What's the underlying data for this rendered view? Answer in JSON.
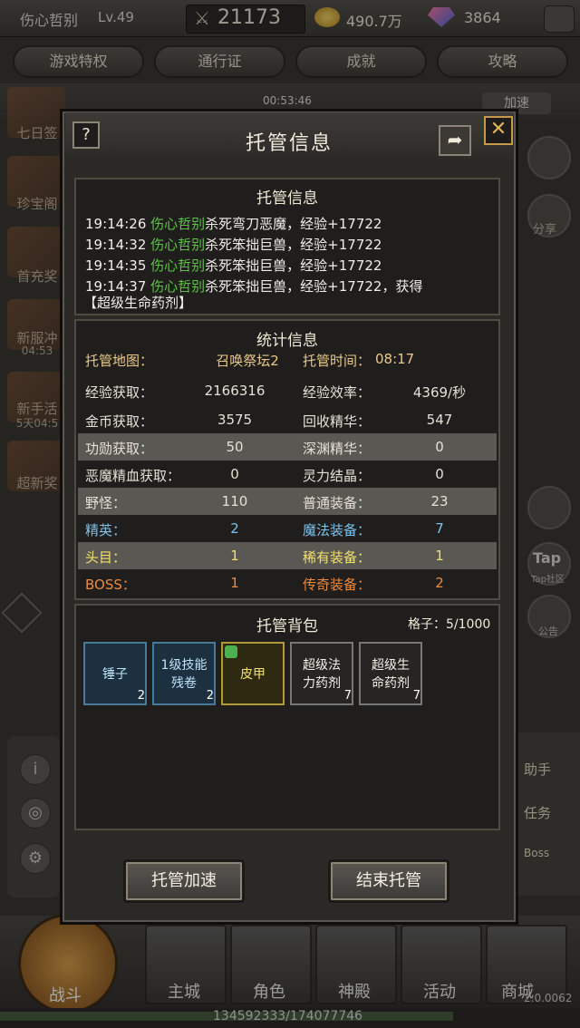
{
  "top": {
    "player_name": "伤心哲别",
    "level": "Lv.49",
    "power": "21173",
    "gold": "490.7万",
    "gems": "3864"
  },
  "tabs": [
    "游戏特权",
    "通行证",
    "成就",
    "攻略"
  ],
  "hud": {
    "timer": "00:53:46",
    "speed": "加速"
  },
  "left_side": [
    "七日签",
    "珍宝阁",
    "首充奖",
    "新服冲",
    "新手活",
    "超新奖"
  ],
  "left_side_sub": [
    "04:53",
    "5天04:5"
  ],
  "right_side_labels": [
    "分享",
    "Tap",
    "Tap社区",
    "公告"
  ],
  "right_panel": [
    "助手",
    "任务",
    "Boss"
  ],
  "bottom_nav": [
    "战斗",
    "主城",
    "角色",
    "神殿",
    "活动",
    "商城"
  ],
  "exp_text": "134592333/174077746",
  "version": "2.0.0062",
  "modal": {
    "title": "托管信息",
    "help": "?",
    "close": "✕",
    "log_section_title": "托管信息",
    "log": [
      {
        "time": "19:14:26",
        "actor": "伤心哲别",
        "text": "杀死弯刀恶魔，经验+17722"
      },
      {
        "time": "19:14:32",
        "actor": "伤心哲别",
        "text": "杀死笨拙巨兽，经验+17722"
      },
      {
        "time": "19:14:35",
        "actor": "伤心哲别",
        "text": "杀死笨拙巨兽，经验+17722"
      },
      {
        "time": "19:14:37",
        "actor": "伤心哲别",
        "text": "杀死笨拙巨兽，经验+17722，获得"
      }
    ],
    "log_tail": "【超级生命药剂】",
    "stats_title": "统计信息",
    "stats": [
      {
        "l1": "托管地图：",
        "v1": "召唤祭坛2",
        "l2": "托管时间：",
        "v2": "08:17"
      },
      {
        "l1": "经验获取：",
        "v1": "2166316",
        "l2": "经验效率：",
        "v2": "4369/秒"
      },
      {
        "l1": "金币获取：",
        "v1": "3575",
        "l2": "回收精华：",
        "v2": "547"
      },
      {
        "l1": "功勋获取：",
        "v1": "50",
        "l2": "深渊精华：",
        "v2": "0"
      },
      {
        "l1": "恶魔精血获取：",
        "v1": "0",
        "l2": "灵力结晶：",
        "v2": "0"
      },
      {
        "l1": "野怪：",
        "v1": "110",
        "l2": "普通装备：",
        "v2": "23"
      },
      {
        "l1": "精英：",
        "v1": "2",
        "l2": "魔法装备：",
        "v2": "7"
      },
      {
        "l1": "头目：",
        "v1": "1",
        "l2": "稀有装备：",
        "v2": "1"
      },
      {
        "l1": "BOSS：",
        "v1": "1",
        "l2": "传奇装备：",
        "v2": "2"
      }
    ],
    "bag_title": "托管背包",
    "bag_capacity": "格子：5/1000",
    "bag_items": [
      {
        "name": "锤子",
        "count": "2"
      },
      {
        "name": "1级技能残卷",
        "count": "2"
      },
      {
        "name": "皮甲",
        "count": ""
      },
      {
        "name": "超级法力药剂",
        "count": "7"
      },
      {
        "name": "超级生命药剂",
        "count": "7"
      }
    ],
    "btn_speed": "托管加速",
    "btn_end": "结束托管"
  }
}
